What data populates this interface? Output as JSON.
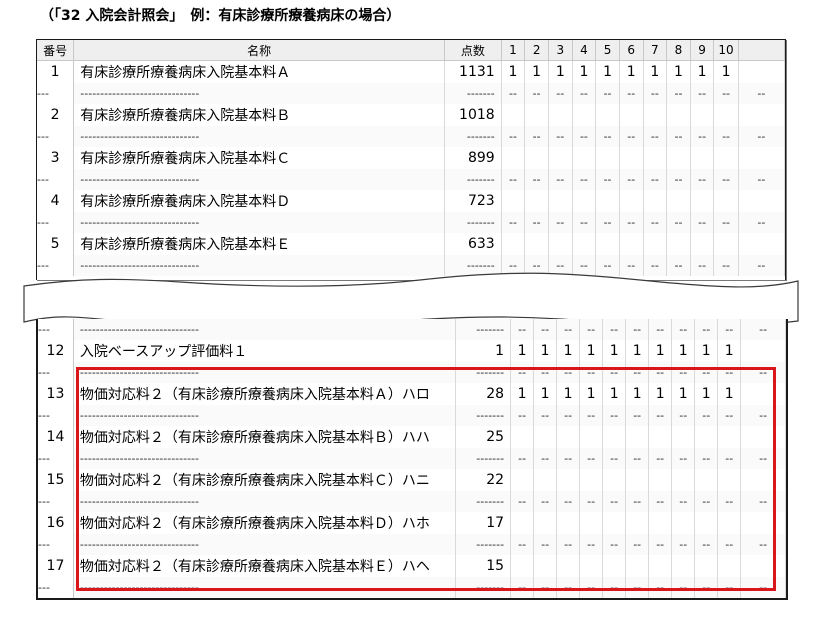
{
  "caption": "（「32 入院会計照会」　例：有床診療所療養病床の場合）",
  "header": {
    "number": "番号",
    "name": "名称",
    "points": "点数",
    "days": [
      "1",
      "2",
      "3",
      "4",
      "5",
      "6",
      "7",
      "8",
      "9",
      "10"
    ]
  },
  "separator": {
    "number": "---",
    "name": "------------------------------",
    "points": "-------",
    "day": "--"
  },
  "top_rows": [
    {
      "number": "1",
      "name": "有床診療所療養病床入院基本料Ａ",
      "points": "1131",
      "days": [
        "1",
        "1",
        "1",
        "1",
        "1",
        "1",
        "1",
        "1",
        "1",
        "1"
      ]
    },
    {
      "number": "2",
      "name": "有床診療所療養病床入院基本料Ｂ",
      "points": "1018",
      "days": [
        "",
        "",
        "",
        "",
        "",
        "",
        "",
        "",
        "",
        ""
      ]
    },
    {
      "number": "3",
      "name": "有床診療所療養病床入院基本料Ｃ",
      "points": "899",
      "days": [
        "",
        "",
        "",
        "",
        "",
        "",
        "",
        "",
        "",
        ""
      ]
    },
    {
      "number": "4",
      "name": "有床診療所療養病床入院基本料Ｄ",
      "points": "723",
      "days": [
        "",
        "",
        "",
        "",
        "",
        "",
        "",
        "",
        "",
        ""
      ]
    },
    {
      "number": "5",
      "name": "有床診療所療養病床入院基本料Ｅ",
      "points": "633",
      "days": [
        "",
        "",
        "",
        "",
        "",
        "",
        "",
        "",
        "",
        ""
      ]
    }
  ],
  "bottom_rows": [
    {
      "number": "12",
      "name": "入院ベースアップ評価料１",
      "points": "1",
      "days": [
        "1",
        "1",
        "1",
        "1",
        "1",
        "1",
        "1",
        "1",
        "1",
        "1"
      ]
    },
    {
      "number": "13",
      "name": "物価対応料２（有床診療所療養病床入院基本料Ａ）ハロ",
      "points": "28",
      "days": [
        "1",
        "1",
        "1",
        "1",
        "1",
        "1",
        "1",
        "1",
        "1",
        "1"
      ]
    },
    {
      "number": "14",
      "name": "物価対応料２（有床診療所療養病床入院基本料Ｂ）ハハ",
      "points": "25",
      "days": [
        "",
        "",
        "",
        "",
        "",
        "",
        "",
        "",
        "",
        ""
      ]
    },
    {
      "number": "15",
      "name": "物価対応料２（有床診療所療養病床入院基本料Ｃ）ハニ",
      "points": "22",
      "days": [
        "",
        "",
        "",
        "",
        "",
        "",
        "",
        "",
        "",
        ""
      ]
    },
    {
      "number": "16",
      "name": "物価対応料２（有床診療所療養病床入院基本料Ｄ）ハホ",
      "points": "17",
      "days": [
        "",
        "",
        "",
        "",
        "",
        "",
        "",
        "",
        "",
        ""
      ]
    },
    {
      "number": "17",
      "name": "物価対応料２（有床診療所療養病床入院基本料Ｅ）ハヘ",
      "points": "15",
      "days": [
        "",
        "",
        "",
        "",
        "",
        "",
        "",
        "",
        "",
        ""
      ]
    }
  ],
  "colors": {
    "highlight": "#d9161c",
    "header_bg": "#efefef"
  }
}
